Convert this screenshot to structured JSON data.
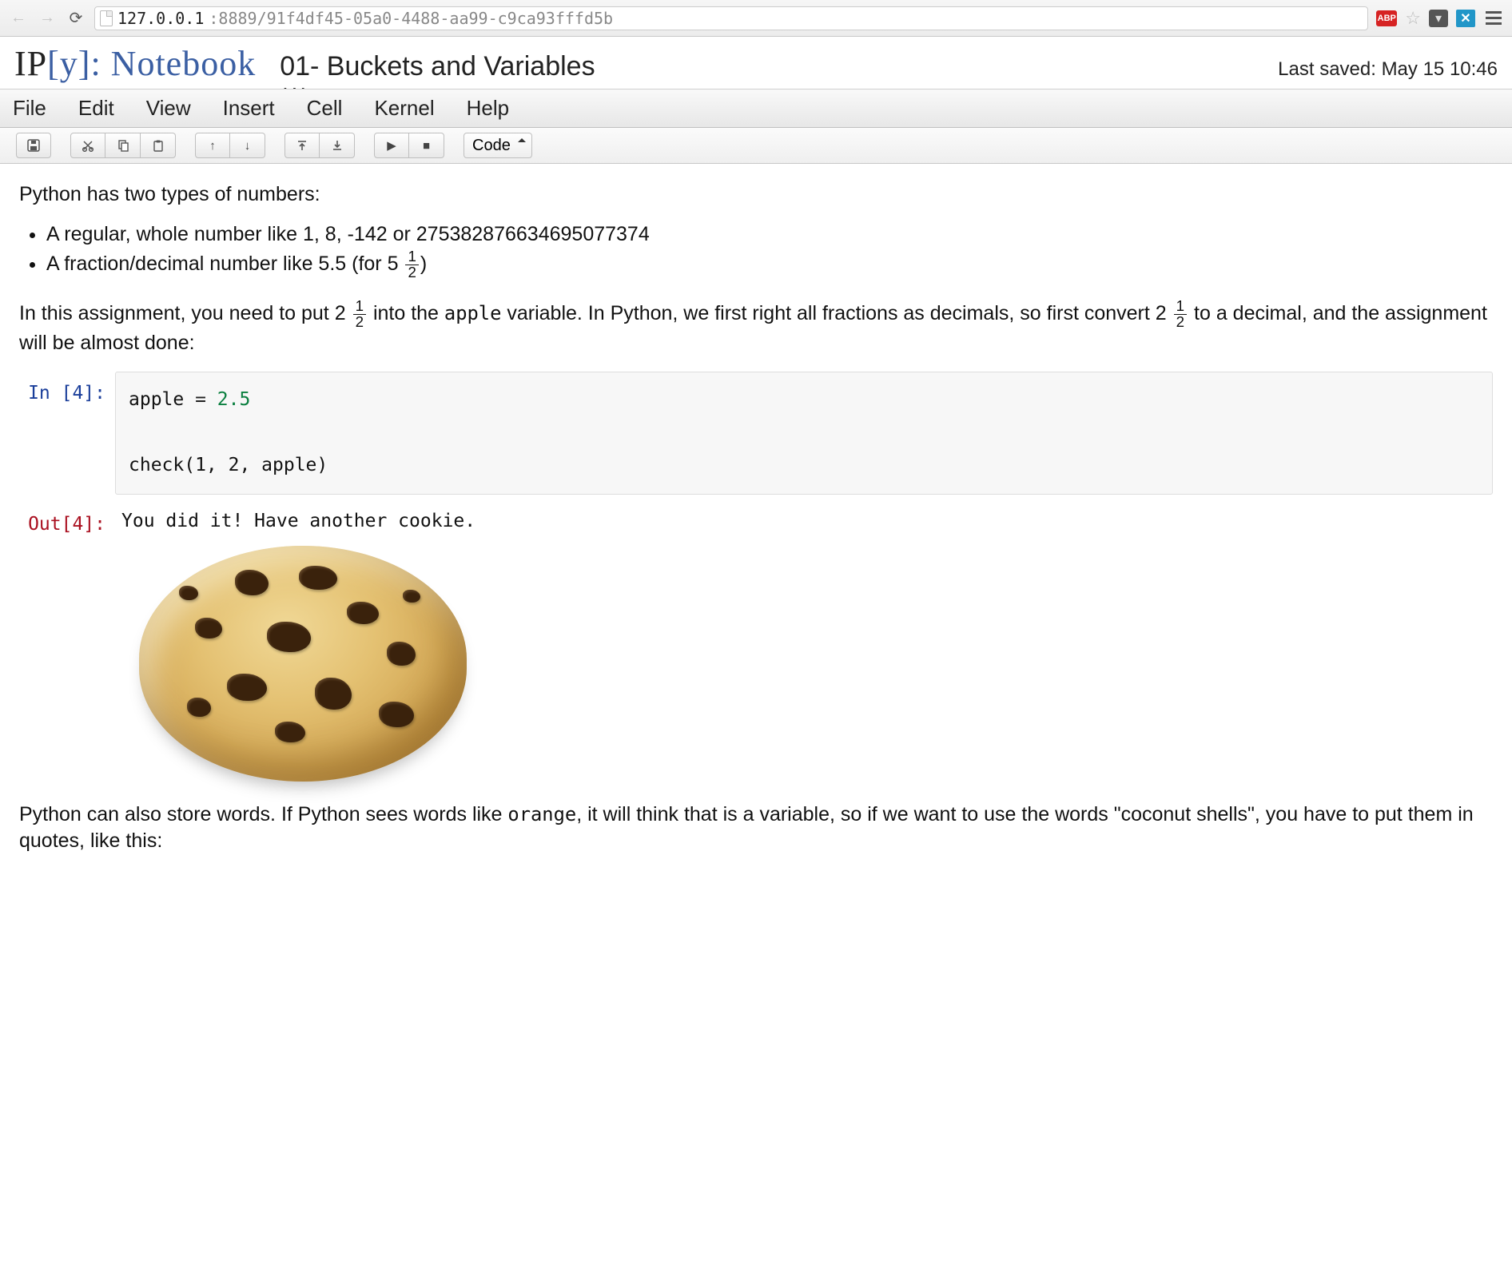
{
  "browser": {
    "url_host": "127.0.0.1",
    "url_port_path": ":8889/91f4df45-05a0-4488-aa99-c9ca93fffd5b",
    "ext_badge": "ABP"
  },
  "header": {
    "logo_ip": "IP",
    "logo_lb": "[",
    "logo_y": "y",
    "logo_rb": "]",
    "logo_colon": ":",
    "logo_notebook": " Notebook",
    "title_main": "01- Buckets and Variables",
    "title_below": "AM",
    "saved_label": "Last saved: May 15 10:46"
  },
  "menu": {
    "items": [
      "File",
      "Edit",
      "View",
      "Insert",
      "Cell",
      "Kernel",
      "Help"
    ]
  },
  "toolbar": {
    "cell_type_value": "Code"
  },
  "content": {
    "para1": "Python has two types of numbers:",
    "bullet1_pre": "A regular, whole number like 1, 8, -142 or 275382876634695077374",
    "bullet2_pre": "A fraction/decimal number like 5.5 (for ",
    "bullet2_whole": "5",
    "bullet2_num": "1",
    "bullet2_den": "2",
    "bullet2_post": ")",
    "para2_a": "In this assignment, you need to put ",
    "frac1_whole": "2",
    "frac1_num": "1",
    "frac1_den": "2",
    "para2_b": " into the ",
    "para2_code": "apple",
    "para2_c": " variable. In Python, we first right all fractions as decimals, so first convert ",
    "frac2_whole": "2",
    "frac2_num": "1",
    "frac2_den": "2",
    "para2_d": " to a decimal, and the assignment will be almost done:",
    "in_prompt": "In [4]:",
    "code_line1_var": "apple",
    "code_line1_eq": " = ",
    "code_line1_val": "2.5",
    "code_line2": "check(1, 2, apple)",
    "out_prompt": "Out[4]:",
    "out_text": "You did it! Have another cookie.",
    "para3_a": "Python can also store words. If Python sees words like ",
    "para3_code": "orange",
    "para3_b": ", it will think that is a variable, so if we want to use the words \"coconut shells\", you have to put them in quotes, like this:"
  }
}
